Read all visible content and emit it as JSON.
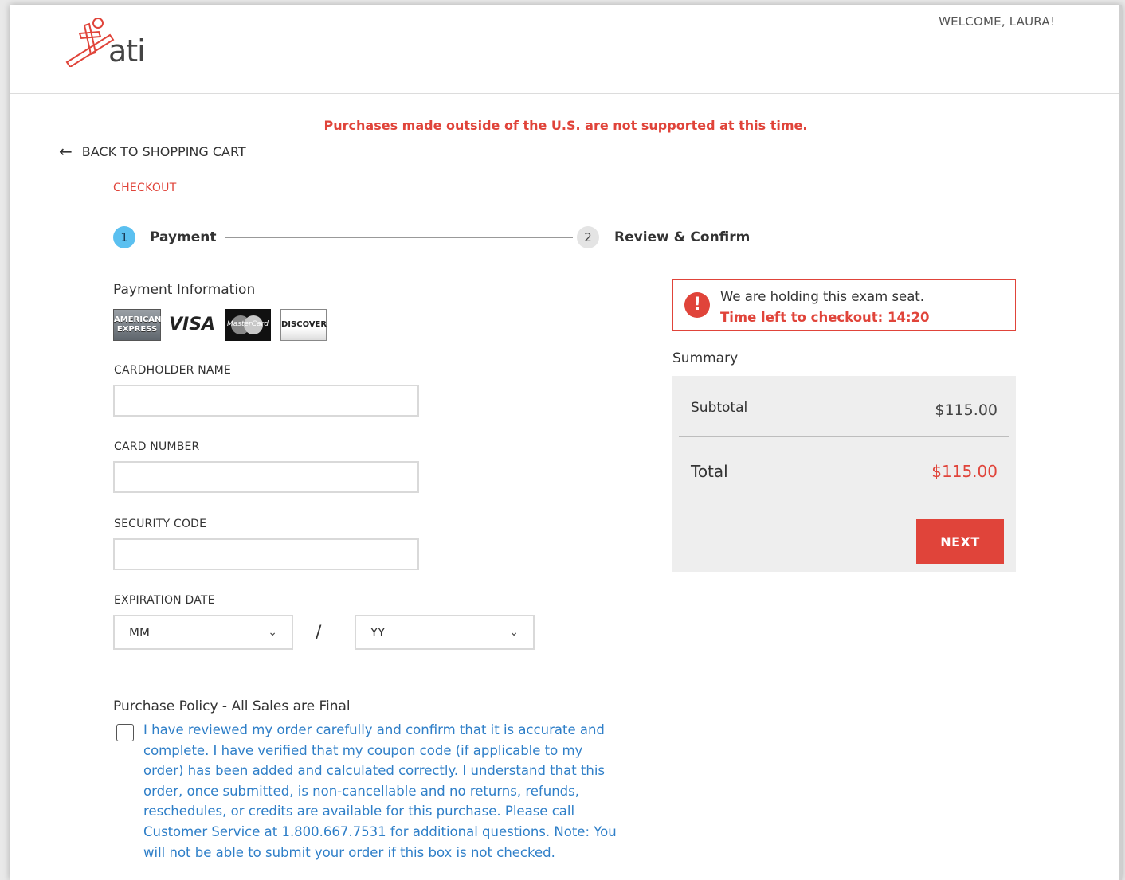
{
  "header": {
    "logo_text": "ati",
    "welcome": "WELCOME, LAURA!"
  },
  "notice": "Purchases made outside of the U.S. are not supported at this time.",
  "back_link": "BACK TO SHOPPING CART",
  "checkout_label": "CHECKOUT",
  "steps": [
    {
      "number": "1",
      "label": "Payment"
    },
    {
      "number": "2",
      "label": "Review & Confirm"
    }
  ],
  "payment": {
    "title": "Payment Information",
    "cards": {
      "amex": "AMERICAN EXPRESS",
      "visa": "VISA",
      "mastercard": "MasterCard",
      "discover": "DISCOVER"
    },
    "cardholder_label": "CARDHOLDER NAME",
    "cardholder_value": "",
    "card_number_label": "CARD NUMBER",
    "card_number_value": "",
    "security_code_label": "SECURITY CODE",
    "security_code_value": "",
    "expiration_label": "EXPIRATION DATE",
    "month_selected": "MM",
    "year_selected": "YY",
    "separator": "/"
  },
  "policy": {
    "title": "Purchase Policy - All Sales are Final",
    "checked": false,
    "text": "I have reviewed my order carefully and confirm that it is accurate and complete. I have verified that my coupon code (if applicable to my order) has been added and calculated correctly. I understand that this order, once submitted, is non-cancellable and no returns, refunds, reschedules, or credits are available for this purchase. Please call Customer Service at 1.800.667.7531 for additional questions. Note: You will not be able to submit your order if this box is not checked."
  },
  "hold": {
    "message": "We are holding this exam seat.",
    "timer": "Time left to checkout: 14:20"
  },
  "summary": {
    "title": "Summary",
    "subtotal_label": "Subtotal",
    "subtotal_value": "$115.00",
    "total_label": "Total",
    "total_value": "$115.00",
    "next_label": "NEXT"
  },
  "colors": {
    "accent_red": "#e0443a",
    "step_active": "#5bc0f0",
    "policy_link": "#2f7fc8"
  }
}
